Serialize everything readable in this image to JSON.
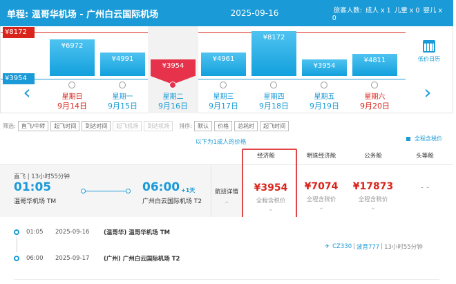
{
  "header": {
    "route": "单程:  温哥华机场 - 广州白云国际机场",
    "date": "2025-09-16",
    "passengers_label": "旅客人数:",
    "adults": "成人 x 1",
    "children": "儿童 x 0",
    "infants": "婴儿 x 0"
  },
  "chart_data": {
    "type": "bar",
    "categories": [
      "9月14日",
      "9月15日",
      "9月16日",
      "9月17日",
      "9月18日",
      "9月19日",
      "9月20日"
    ],
    "weekdays": [
      "星期日",
      "星期一",
      "星期二",
      "星期三",
      "星期四",
      "星期五",
      "星期六"
    ],
    "values": [
      6972,
      4991,
      3954,
      4961,
      8172,
      3954,
      4811
    ],
    "value_labels": [
      "¥6972",
      "¥4991",
      "¥3954",
      "¥4961",
      "¥8172",
      "¥3954",
      "¥4811"
    ],
    "selected_index": 2,
    "weekend_indices": [
      0,
      6
    ],
    "max_label": "¥8172",
    "min_label": "¥3954",
    "max_value": 8172,
    "min_value": 3954,
    "colors": {
      "bar": "#1a9ad6",
      "selected": "#e6334b",
      "max_line": "#d9241b",
      "min_line": "#1a9ad6"
    }
  },
  "calendar": {
    "label": "低价日历",
    "icon": "calendar-icon"
  },
  "filters": {
    "label": "筛选:",
    "chips": [
      "直飞/中转",
      "起飞时间",
      "到达时间",
      "起飞机场",
      "到达机场"
    ],
    "disabled": [
      false,
      false,
      false,
      true,
      true
    ],
    "sort_label": "排序:",
    "sort_chips": [
      "默认",
      "价格",
      "总耗时",
      "起飞时间"
    ]
  },
  "adult_price_note": "以下为1成人的价格",
  "tax_toggle": "全程含税价",
  "cabins": [
    "经济舱",
    "明珠经济舱",
    "公务舱",
    "头等舱"
  ],
  "flight": {
    "type": "直飞 | 13小时55分钟",
    "dep_time": "01:05",
    "dep_airport": "温哥华机场 TM",
    "arr_time": "06:00",
    "plus_day": "+1天",
    "arr_airport": "广州白云国际机场 T2",
    "detail_label": "航班详情",
    "prices": [
      "¥3954",
      "¥7074",
      "¥17873",
      "- -"
    ],
    "price_note": "全程含税价",
    "legs": [
      {
        "time": "01:05",
        "date": "2025-09-16",
        "airport": "(温哥华) 温哥华机场 TM"
      },
      {
        "time": "06:00",
        "date": "2025-09-17",
        "airport": "(广州) 广州白云国际机场 T2"
      }
    ],
    "flight_no": "CZ330",
    "aircraft": "波音777",
    "duration": "13小时55分钟"
  }
}
